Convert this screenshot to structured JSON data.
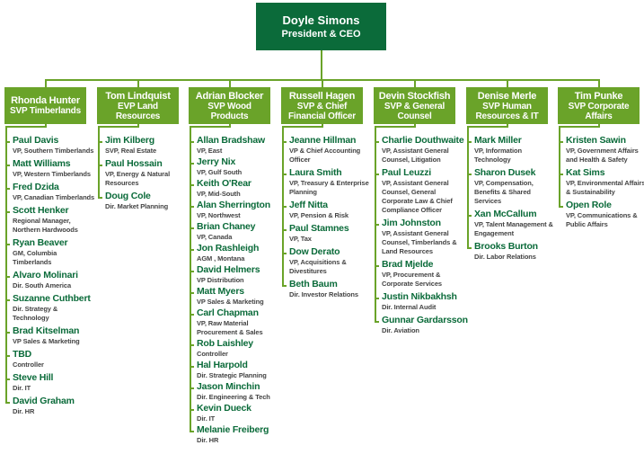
{
  "colors": {
    "ceo_box": "#0b6b3a",
    "svp_box": "#6aa329",
    "name_text": "#0b6b3a",
    "connector": "#6aa329"
  },
  "ceo": {
    "name": "Doyle Simons",
    "title": "President & CEO"
  },
  "columns": [
    {
      "name": "Rhonda Hunter",
      "title": "SVP Timberlands",
      "reports": [
        {
          "name": "Paul Davis",
          "title": "VP, Southern Timberlands"
        },
        {
          "name": "Matt Williams",
          "title": "VP, Western Timberlands"
        },
        {
          "name": "Fred Dzida",
          "title": "VP, Canadian Timberlands"
        },
        {
          "name": "Scott Henker",
          "title": "Regional Manager, Northern Hardwoods"
        },
        {
          "name": "Ryan Beaver",
          "title": "GM, Columbia Timberlands"
        },
        {
          "name": "Alvaro Molinari",
          "title": "Dir. South America"
        },
        {
          "name": "Suzanne Cuthbert",
          "title": "Dir. Strategy & Technology"
        },
        {
          "name": "Brad Kitselman",
          "title": "VP Sales & Marketing"
        },
        {
          "name": "TBD",
          "title": "Controller"
        },
        {
          "name": "Steve Hill",
          "title": "Dir. IT"
        },
        {
          "name": "David Graham",
          "title": "Dir. HR"
        }
      ]
    },
    {
      "name": "Tom Lindquist",
      "title": "EVP Land Resources",
      "reports": [
        {
          "name": "Jim Kilberg",
          "title": "SVP, Real Estate"
        },
        {
          "name": "Paul Hossain",
          "title": "VP, Energy & Natural Resources"
        },
        {
          "name": "Doug Cole",
          "title": "Dir. Market Planning"
        }
      ]
    },
    {
      "name": "Adrian Blocker",
      "title": "SVP Wood Products",
      "reports": [
        {
          "name": "Allan Bradshaw",
          "title": "VP, East"
        },
        {
          "name": "Jerry Nix",
          "title": "VP, Gulf South"
        },
        {
          "name": "Keith O'Rear",
          "title": "VP, Mid-South"
        },
        {
          "name": "Alan Sherrington",
          "title": "VP, Northwest"
        },
        {
          "name": "Brian Chaney",
          "title": "VP, Canada"
        },
        {
          "name": "Jon Rashleigh",
          "title": "AGM , Montana"
        },
        {
          "name": "David Helmers",
          "title": "VP Distribution"
        },
        {
          "name": "Matt Myers",
          "title": "VP Sales & Marketing"
        },
        {
          "name": "Carl Chapman",
          "title": "VP, Raw Material Procurement & Sales"
        },
        {
          "name": "Rob Laishley",
          "title": "Controller"
        },
        {
          "name": "Hal Harpold",
          "title": "Dir. Strategic Planning"
        },
        {
          "name": "Jason Minchin",
          "title": "Dir. Engineering & Tech"
        },
        {
          "name": "Kevin Dueck",
          "title": "Dir. IT"
        },
        {
          "name": "Melanie Freiberg",
          "title": "Dir. HR"
        }
      ]
    },
    {
      "name": "Russell Hagen",
      "title": "SVP & Chief Financial Officer",
      "reports": [
        {
          "name": "Jeanne Hillman",
          "title": "VP & Chief Accounting Officer"
        },
        {
          "name": "Laura Smith",
          "title": "VP, Treasury & Enterprise Planning"
        },
        {
          "name": "Jeff Nitta",
          "title": "VP, Pension & Risk"
        },
        {
          "name": "Paul Stamnes",
          "title": "VP, Tax"
        },
        {
          "name": "Dow Derato",
          "title": "VP, Acquisitions & Divestitures"
        },
        {
          "name": "Beth Baum",
          "title": "Dir. Investor Relations"
        }
      ]
    },
    {
      "name": "Devin Stockfish",
      "title": "SVP & General Counsel",
      "reports": [
        {
          "name": "Charlie Douthwaite",
          "title": "VP, Assistant General Counsel, Litigation"
        },
        {
          "name": "Paul Leuzzi",
          "title": "VP, Assistant General Counsel, General Corporate Law & Chief Compliance Officer"
        },
        {
          "name": "Jim Johnston",
          "title": "VP, Assistant General Counsel, Timberlands & Land Resources"
        },
        {
          "name": "Brad Mjelde",
          "title": "VP, Procurement & Corporate Services"
        },
        {
          "name": "Justin Nikbakhsh",
          "title": "Dir. Internal Audit"
        },
        {
          "name": "Gunnar Gardarsson",
          "title": "Dir. Aviation"
        }
      ]
    },
    {
      "name": "Denise Merle",
      "title": "SVP Human Resources & IT",
      "reports": [
        {
          "name": "Mark Miller",
          "title": "VP, Information Technology"
        },
        {
          "name": "Sharon Dusek",
          "title": "VP, Compensation, Benefits & Shared Services"
        },
        {
          "name": "Xan McCallum",
          "title": "VP, Talent Management & Engagement"
        },
        {
          "name": "Brooks Burton",
          "title": "Dir. Labor Relations"
        }
      ]
    },
    {
      "name": "Tim Punke",
      "title": "SVP Corporate Affairs",
      "reports": [
        {
          "name": "Kristen Sawin",
          "title": "VP, Government Affairs and Health & Safety"
        },
        {
          "name": "Kat Sims",
          "title": "VP, Environmental Affairs & Sustainability"
        },
        {
          "name": "Open Role",
          "title": "VP, Communications & Public Affairs"
        }
      ]
    }
  ]
}
